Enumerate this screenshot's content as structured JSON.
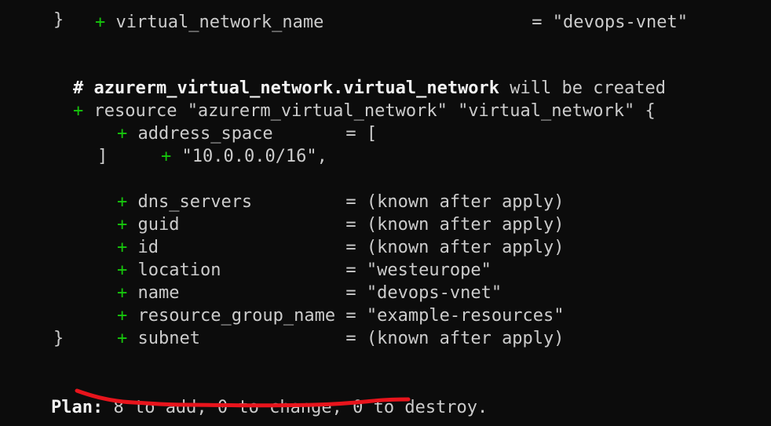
{
  "terminal": {
    "lines": {
      "partial_top": "virtual_network_name                    = \"devops-vnet\"",
      "close_prev": "}",
      "comment_hash": "# ",
      "comment_resource": "azurerm_virtual_network.virtual_network",
      "comment_suffix": " will be created",
      "resource_decl": "resource \"azurerm_virtual_network\" \"virtual_network\" {",
      "address_space": "address_space       = [",
      "address_value": "\"10.0.0.0/16\",",
      "bracket_close": "]",
      "dns_servers": "dns_servers         = (known after apply)",
      "guid": "guid                = (known after apply)",
      "id": "id                  = (known after apply)",
      "location": "location            = \"westeurope\"",
      "name": "name                = \"devops-vnet\"",
      "resource_group_name": "resource_group_name = \"example-resources\"",
      "subnet": "subnet              = (known after apply)",
      "close_resource": "}"
    },
    "plus_sign": "+",
    "plan": {
      "label": "Plan:",
      "summary": " 8 to add, 0 to change, 0 to destroy."
    },
    "colors": {
      "background": "#0c0c0c",
      "text": "#cccccc",
      "plus": "#16c60c",
      "annotation": "#e8141c"
    }
  }
}
